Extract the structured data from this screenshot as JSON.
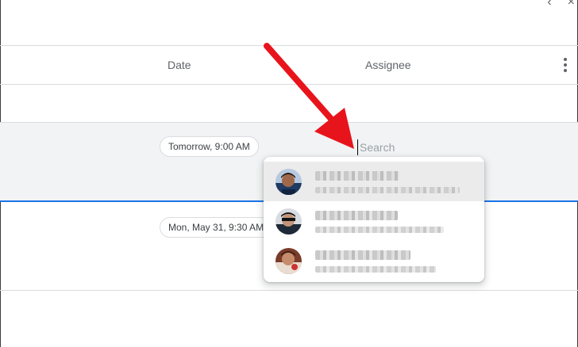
{
  "header": {
    "columns": {
      "date": "Date",
      "assignee": "Assignee"
    }
  },
  "tasks": [
    {
      "date_chip": "Tomorrow, 9:00 AM"
    },
    {
      "date_chip": "Mon, May 31, 9:30 AM"
    }
  ],
  "assignee_search": {
    "placeholder": "Search",
    "value": ""
  },
  "dropdown": {
    "people": [
      {
        "avatar": "avatar-person-1",
        "highlighted": true
      },
      {
        "avatar": "avatar-person-2",
        "highlighted": false
      },
      {
        "avatar": "avatar-person-3",
        "highlighted": false
      }
    ]
  },
  "icons": {
    "more": "more-vert-icon",
    "annotation": "red-arrow-annotation"
  },
  "colors": {
    "accent": "#1a73e8",
    "selected_row_bg": "#f1f3f4",
    "annotation_arrow": "#e8141c"
  }
}
